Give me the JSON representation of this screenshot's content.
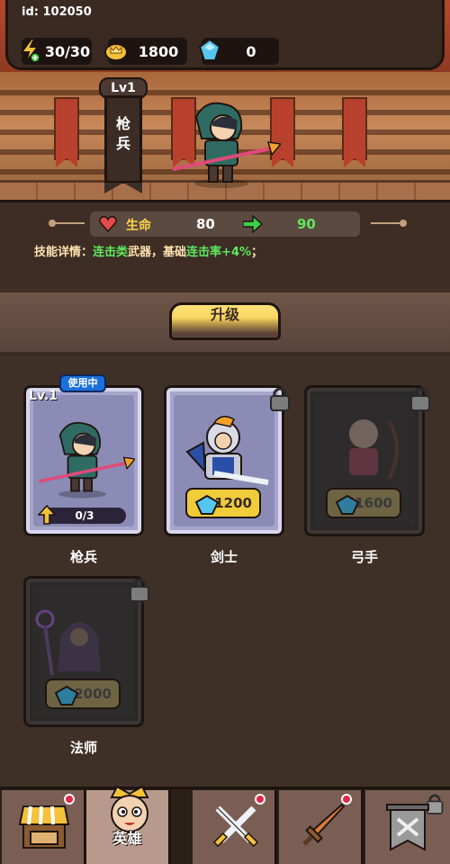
{
  "header": {
    "user_id": "id: 102050",
    "energy": "30/30",
    "gold": "1800",
    "gems": "0"
  },
  "featured_hero": {
    "level": "Lv1",
    "class_name_line1": "枪",
    "class_name_line2": "兵"
  },
  "stats": {
    "hp_label": "生命",
    "hp_current": "80",
    "hp_next": "90",
    "skill_prefix": "技能详情：",
    "skill_type": "连击类",
    "skill_mid": "武器，基础",
    "skill_bonus": "连击率+4%",
    "skill_suffix": "；"
  },
  "upgrade": {
    "label": "升级"
  },
  "heroes": [
    {
      "name": "枪兵",
      "badge": "使用中",
      "level": "Lv.1",
      "progress": "0/3",
      "state": "active"
    },
    {
      "name": "剑士",
      "price": "1200",
      "state": "unlockable"
    },
    {
      "name": "弓手",
      "price": "1600",
      "state": "locked"
    },
    {
      "name": "法师",
      "price": "2000",
      "state": "locked"
    }
  ],
  "nav": {
    "shop_icon": "shop-icon",
    "heroes_label": "英雄",
    "battle_icon": "crossed-swords-icon",
    "weapon_icon": "sword-icon",
    "guild_icon": "banner-icon"
  },
  "colors": {
    "accent_yellow": "#f3c13a",
    "green_text": "#5ee85e",
    "badge_blue": "#1c6fd8",
    "notification_red": "#e0284a"
  }
}
